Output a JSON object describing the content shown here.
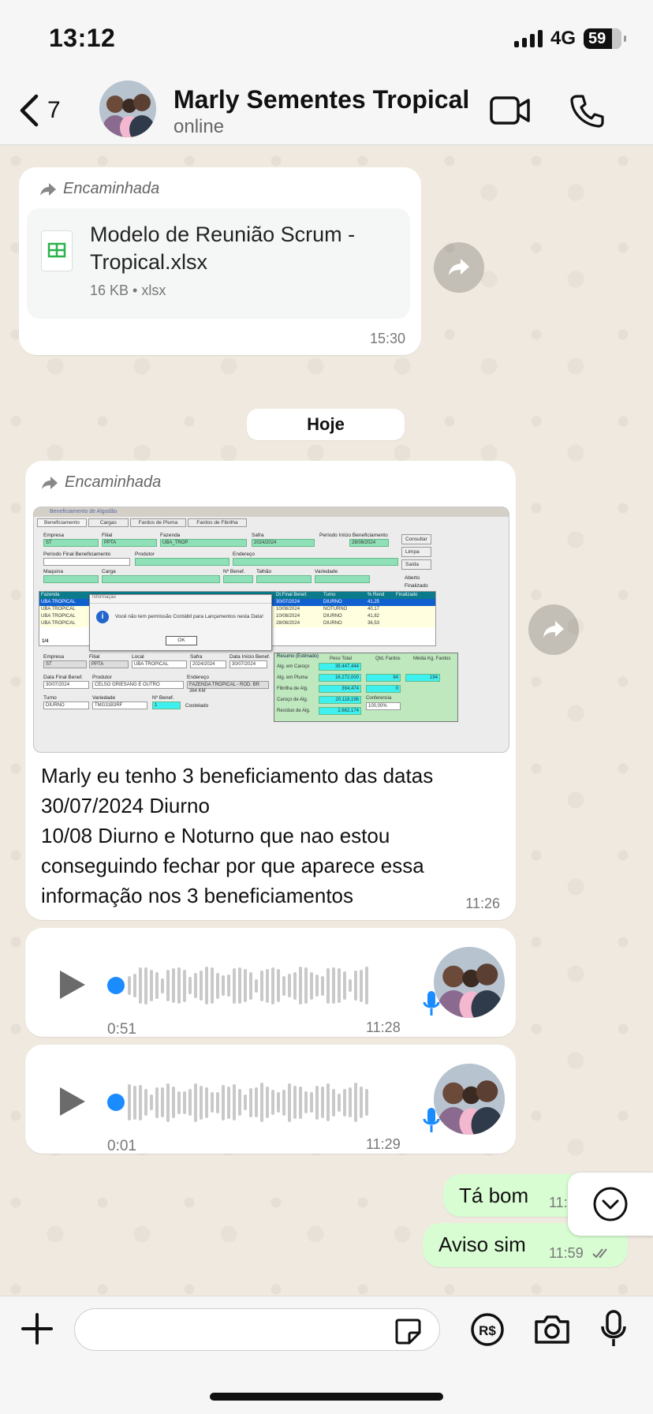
{
  "status_bar": {
    "time": "13:12",
    "network": "4G",
    "battery": "59"
  },
  "header": {
    "back_count": "7",
    "contact_name": "Marly Sementes Tropical",
    "contact_status": "online"
  },
  "messages": {
    "m1": {
      "forwarded_label": "Encaminhada",
      "file_name": "Modelo de Reunião Scrum - Tropical.xlsx",
      "file_info": "16 KB • xlsx",
      "time": "15:30"
    },
    "date_divider": "Hoje",
    "m2": {
      "forwarded_label": "Encaminhada",
      "text_lines": [
        "Marly eu tenho 3 beneficiamento das datas",
        "30/07/2024 Diurno",
        "10/08 Diurno e Noturno que nao estou",
        "conseguindo fechar por que aparece essa",
        "informação nos 3 beneficiamentos"
      ],
      "time": "11:26",
      "screenshot": {
        "window_title": "Beneficiamento de Algodão",
        "tabs": [
          "Beneficiamento",
          "Cargas",
          "Fardos de Pluma",
          "Fardos de Fibrilha"
        ],
        "buttons": [
          "Consultar",
          "Limpa",
          "Saída"
        ],
        "dialog_title": "Informação",
        "dialog_text": "Você não tem permissão Contábil para Lançamentos nesta Data!",
        "dialog_ok": "OK",
        "fields": {
          "empresa": "ST",
          "filial": "PPTA",
          "fazenda": "UBA_TROP",
          "safra": "2024/2024",
          "periodo_inicio": "28/08/2024",
          "aberto": "Aberto",
          "finalizado": "Finalizado"
        },
        "table_headers": [
          "Fazenda",
          "Dt.Final Benef.",
          "Turno",
          "% Rend",
          "Finalizado"
        ],
        "rows": [
          {
            "fazenda": "UBA TROPICAL",
            "dt_final": "30/07/2024",
            "turno": "DIURNO",
            "rend": "41,25"
          },
          {
            "fazenda": "UBA TROPICAL",
            "dt_final": "10/08/2024",
            "turno": "NOTURNO",
            "rend": "40,17"
          },
          {
            "fazenda": "UBA TROPICAL",
            "dt_final": "10/08/2024",
            "turno": "DIURNO",
            "rend": "41,82"
          },
          {
            "fazenda": "UBA TROPICAL",
            "dt_final": "28/08/2024",
            "turno": "DIURNO",
            "rend": "36,53"
          }
        ],
        "pager": "1/4",
        "detail": {
          "empresa": "ST",
          "filial": "PPTA",
          "local": "UBA TROPICAL",
          "safra": "2024/2024",
          "data_inicio": "30/07/2024",
          "data_final": "30/07/2024",
          "produtor": "CELSO GRIESANG E OUTRO",
          "endereco": "FAZENDA TROPICAL - ROD. BR 364 KM",
          "turno": "DIURNO",
          "variedade": "TMG31B3RF",
          "costelado": "Costelado"
        },
        "resumo_title": "Resumo (Estimado)",
        "resumo_headers": [
          "Peso Total",
          "Qtd. Fardos",
          "Média Kg. Fardos"
        ],
        "resumo": [
          {
            "label": "Alg. em Caroço",
            "value": "39.447,444"
          },
          {
            "label": "Alg. em Pluma",
            "value": "16.272,000",
            "qtd": "84",
            "media": "194"
          },
          {
            "label": "Fibrilha de Alg.",
            "value": "394,474",
            "qtd": "0"
          },
          {
            "label": "Caroço de Alg.",
            "value": "20.118,196"
          },
          {
            "label": "Resíduo de Alg.",
            "value": "2.662,174"
          }
        ],
        "conferencia_label": "Conferencia",
        "conferencia_value": "100,00%"
      }
    },
    "m3": {
      "duration": "0:51",
      "time": "11:28"
    },
    "m4": {
      "duration": "0:01",
      "time": "11:29"
    },
    "m5": {
      "text": "Tá bom",
      "time": "11:59"
    },
    "m6": {
      "text": "Aviso sim",
      "time": "11:59"
    }
  },
  "colors": {
    "outgoing_bubble": "#d9fdd3",
    "incoming_bubble": "#ffffff",
    "audio_accent": "#1a8cff"
  },
  "icons": [
    "back-chevron-icon",
    "video-call-icon",
    "phone-icon",
    "forward-arrow-icon",
    "spreadsheet-icon",
    "play-icon",
    "mic-icon",
    "chevron-down-icon",
    "plus-icon",
    "sticker-icon",
    "payment-icon",
    "camera-icon",
    "microphone-icon"
  ]
}
